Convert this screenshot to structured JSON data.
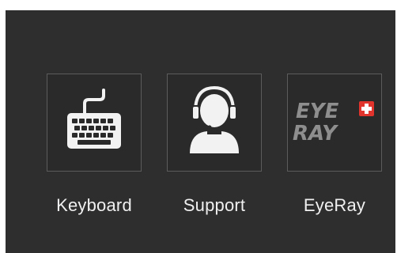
{
  "launcher": {
    "items": [
      {
        "id": "keyboard",
        "label": "Keyboard",
        "icon": "keyboard-icon"
      },
      {
        "id": "support",
        "label": "Support",
        "icon": "support-headset-icon"
      },
      {
        "id": "eyeray",
        "label": "EyeRay",
        "icon": "eyeray-logo",
        "logo_text_top": "EYE",
        "logo_text_bottom": "RAY"
      }
    ]
  },
  "colors": {
    "panel_bg": "#2e2e2f",
    "tile_border": "#5c5c5c",
    "icon": "#f2f2f2",
    "logo_grey": "#8e8e8e",
    "logo_accent": "#e0342c"
  }
}
